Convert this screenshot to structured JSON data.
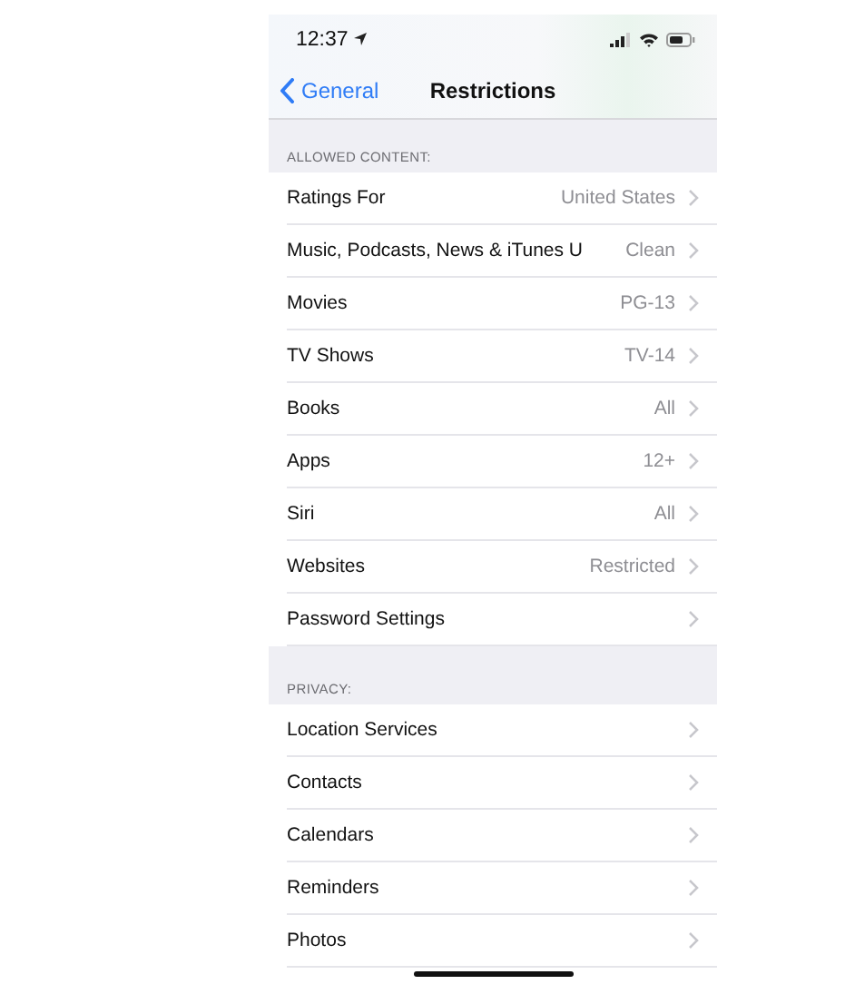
{
  "status_bar": {
    "time": "12:37"
  },
  "nav_bar": {
    "back": "General",
    "title": "Restrictions"
  },
  "sections": [
    {
      "header": "ALLOWED CONTENT:",
      "rows": [
        {
          "label": "Ratings For",
          "value": "United States"
        },
        {
          "label": "Music, Podcasts, News & iTunes U",
          "value": "Clean"
        },
        {
          "label": "Movies",
          "value": "PG-13"
        },
        {
          "label": "TV Shows",
          "value": "TV-14"
        },
        {
          "label": "Books",
          "value": "All"
        },
        {
          "label": "Apps",
          "value": "12+"
        },
        {
          "label": "Siri",
          "value": "All"
        },
        {
          "label": "Websites",
          "value": "Restricted"
        },
        {
          "label": "Password Settings"
        }
      ]
    },
    {
      "header": "PRIVACY:",
      "rows": [
        {
          "label": "Location Services"
        },
        {
          "label": "Contacts"
        },
        {
          "label": "Calendars"
        },
        {
          "label": "Reminders"
        },
        {
          "label": "Photos"
        }
      ]
    }
  ]
}
